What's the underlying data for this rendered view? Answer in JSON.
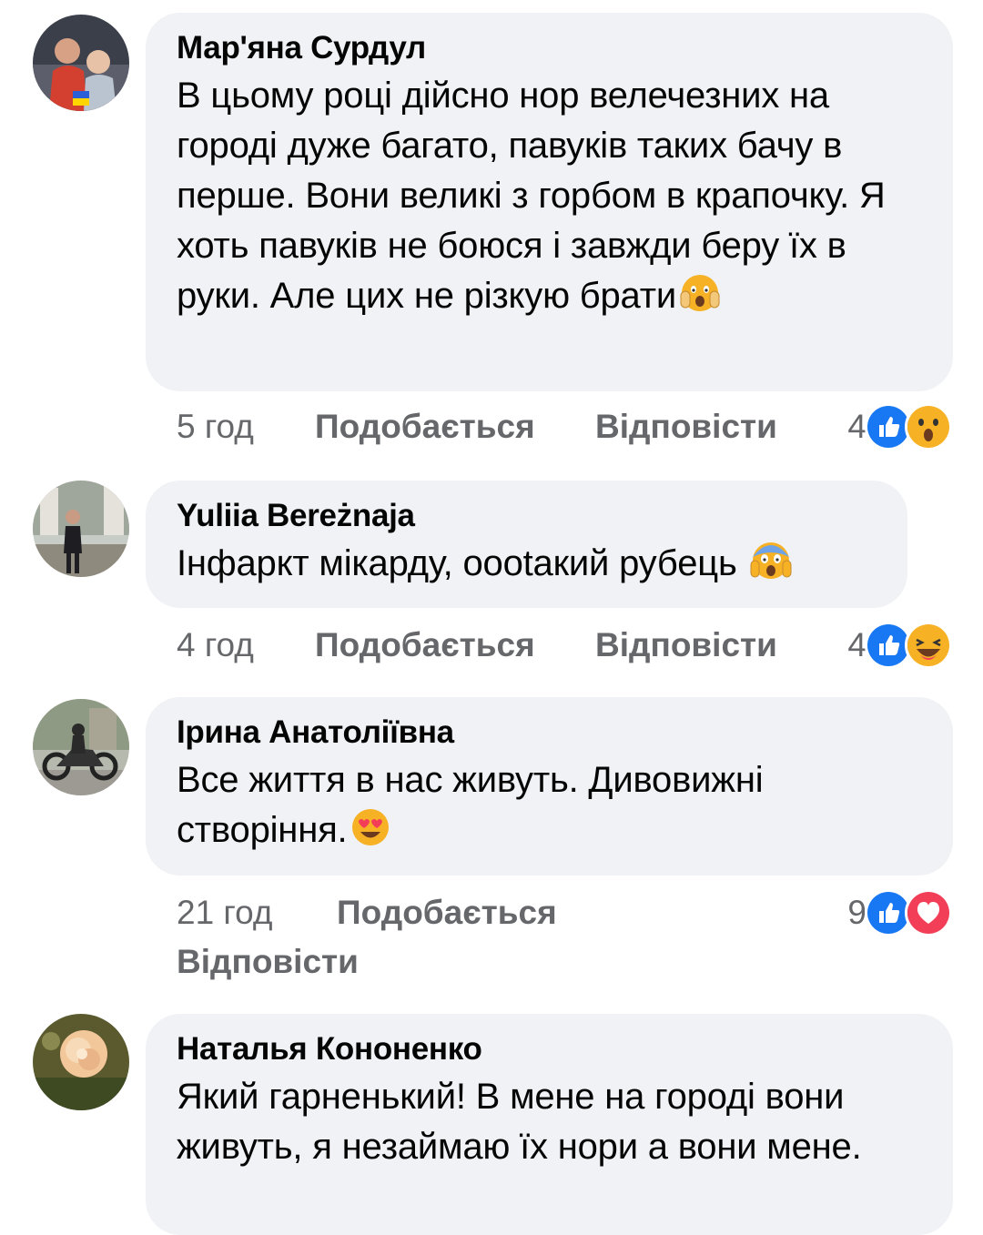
{
  "colors": {
    "bubble": "#f0f2f5",
    "meta": "#65676b",
    "like": "#1877f2",
    "love": "#f33e58",
    "emoji": "#f7b125"
  },
  "comments": [
    {
      "name": "Мар'яна Сурдул",
      "text": "В цьому році дійсно нор велечезних на городі дуже багато, павуків таких бачу в перше. Вони великі з горбом в крапочку. Я хоть павуків не боюся і завжди беру їх в руки. Але цих не різкую брати",
      "inline_emoji": "face-screaming-hands-emoji",
      "time": "5 год",
      "like_label": "Подобається",
      "reply_label": "Відповісти",
      "reaction_count": "4",
      "reactions": [
        "like-reaction-icon",
        "wow-reaction-icon"
      ]
    },
    {
      "name": "Yuliia Bereżnaja",
      "text": "Інфаркт мікарду, оootакий рубець",
      "inline_emoji": "face-screaming-in-fear-emoji",
      "time": "4 год",
      "like_label": "Подобається",
      "reply_label": "Відповісти",
      "reaction_count": "4",
      "reactions": [
        "like-reaction-icon",
        "haha-reaction-icon"
      ]
    },
    {
      "name": "Ірина Анатоліївна",
      "text": "Все життя в нас живуть. Дивовижні створіння.",
      "inline_emoji": "heart-eyes-emoji",
      "time": "21 год",
      "like_label": "Подобається",
      "reply_label": "Відповісти",
      "reaction_count": "9",
      "reactions": [
        "like-reaction-icon",
        "love-reaction-icon"
      ]
    },
    {
      "name": "Наталья Кононенко",
      "text": "Який гарненький! В мене на городі вони живуть, я незаймаю їх нори а вони мене.",
      "inline_emoji": "",
      "time": "",
      "like_label": "",
      "reply_label": "",
      "reaction_count": "",
      "reactions": []
    }
  ]
}
